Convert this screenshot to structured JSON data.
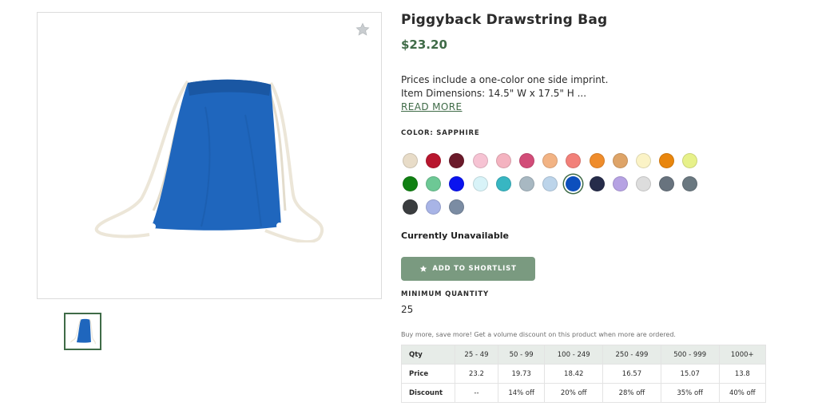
{
  "product": {
    "title": "Piggyback Drawstring Bag",
    "price": "$23.20",
    "description_lines": [
      "Prices include a one-color one side imprint.",
      "Item Dimensions: 14.5\" W x 17.5\" H ..."
    ],
    "read_more": "READ MORE",
    "color_label": "COLOR: SAPPHIRE",
    "availability": "Currently Unavailable",
    "shortlist_button": "ADD TO SHORTLIST",
    "min_quantity_label": "MINIMUM QUANTITY",
    "min_quantity_value": "25",
    "promo_text": "Buy more, save more! Get a volume discount on this product when more are ordered.",
    "bag_color": "#1f66bd",
    "accent_color": "#3f6b47"
  },
  "icons": {
    "favorite": "star-icon",
    "shortlist": "star-icon"
  },
  "swatch_rows": [
    [
      "#e8dcc8",
      "#b8162e",
      "#6b1a2a",
      "#f6c3d3",
      "#f4b3c0",
      "#d24c78",
      "#f2b384",
      "#f28079",
      "#ef8c2b",
      "#dea468",
      "#fbf3c6",
      "#e9860d",
      "#e7f18a"
    ],
    [
      "#108012",
      "#6dc895",
      "#0a13ef",
      "#d8f3f8",
      "#38b6c2",
      "#a8b8c2",
      "#bcd4ea",
      "#0d4fbd",
      "#262c4a",
      "#b6a2e3",
      "#dddddd",
      "#68737e",
      "#6a7880"
    ],
    [
      "#3a3d3f",
      "#a8b4e6",
      "#7b8ca3"
    ]
  ],
  "selected_swatch": [
    1,
    7
  ],
  "volume_table": {
    "headers": [
      "Qty",
      "25 - 49",
      "50 - 99",
      "100 - 249",
      "250 - 499",
      "500 - 999",
      "1000+"
    ],
    "rows": [
      [
        "Price",
        "23.2",
        "19.73",
        "18.42",
        "16.57",
        "15.07",
        "13.8"
      ],
      [
        "Discount",
        "--",
        "14% off",
        "20% off",
        "28% off",
        "35% off",
        "40% off"
      ]
    ]
  }
}
